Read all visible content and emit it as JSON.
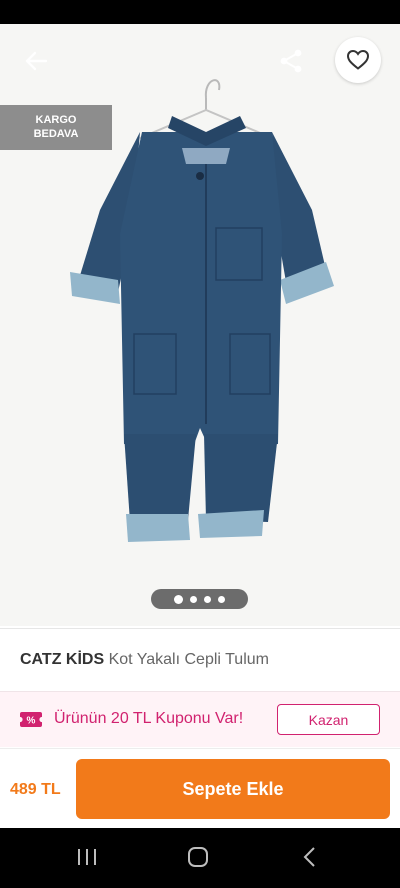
{
  "hero": {
    "badge_line1": "KARGO",
    "badge_line2": "BEDAVA",
    "slide_count": 4,
    "active_slide": 1
  },
  "icons": {
    "back": "arrow-left-icon",
    "share": "share-icon",
    "favorite": "heart-outline-icon",
    "coupon": "coupon-percent-icon",
    "nav_recents": "recents-icon",
    "nav_home": "home-icon",
    "nav_back": "back-chevron-icon"
  },
  "product": {
    "brand": "CATZ KİDS",
    "name": "Kot Yakalı Cepli Tulum"
  },
  "coupon": {
    "text": "Ürünün 20 TL Kuponu Var!",
    "button": "Kazan"
  },
  "buy": {
    "price": "489 TL",
    "add_to_cart": "Sepete Ekle"
  },
  "colors": {
    "accent": "#f27a1a",
    "coupon": "#d1226f",
    "badge": "#8d8d8d"
  }
}
